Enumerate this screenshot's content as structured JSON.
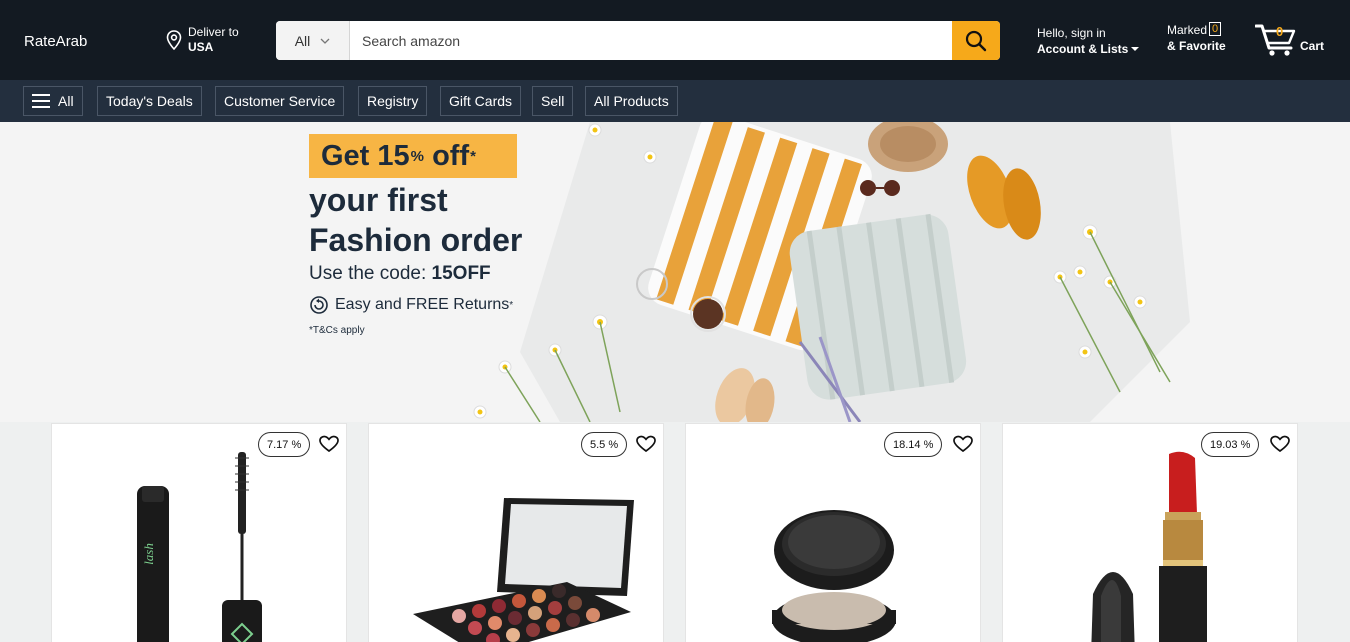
{
  "header": {
    "brand": "RateArab",
    "deliver_label": "Deliver to",
    "deliver_location": "USA",
    "search_category": "All",
    "search_placeholder": "Search amazon",
    "account_line1": "Hello, sign in",
    "account_line2": "Account & Lists",
    "marked_label": "Marked",
    "marked_count": "0",
    "favorite_label": "& Favorite",
    "cart_count": "0",
    "cart_label": "Cart"
  },
  "nav": {
    "items": [
      "All",
      "Today's Deals",
      "Customer Service",
      "Registry",
      "Gift Cards",
      "Sell",
      "All Products"
    ]
  },
  "banner": {
    "promo_main": "Get 15",
    "promo_sup": "%",
    "promo_rest": " off",
    "promo_star": "*",
    "headline_1": "your first",
    "headline_2": "Fashion order",
    "code_prefix": "Use the code: ",
    "code_value": "15OFF",
    "returns_text": "Easy and FREE Returns",
    "returns_star": "*",
    "terms": "*T&Cs apply"
  },
  "products": [
    {
      "discount": "7.17 %",
      "image": "mascara"
    },
    {
      "discount": "5.5 %",
      "image": "eyeshadow-palette"
    },
    {
      "discount": "18.14 %",
      "image": "compact-powder"
    },
    {
      "discount": "19.03 %",
      "image": "lipstick"
    }
  ],
  "colors": {
    "header_bg": "#131a22",
    "nav_bg": "#232f3e",
    "search_button": "#f6a91a",
    "accent": "#f6a91a",
    "promo_tag": "#f7b544"
  }
}
